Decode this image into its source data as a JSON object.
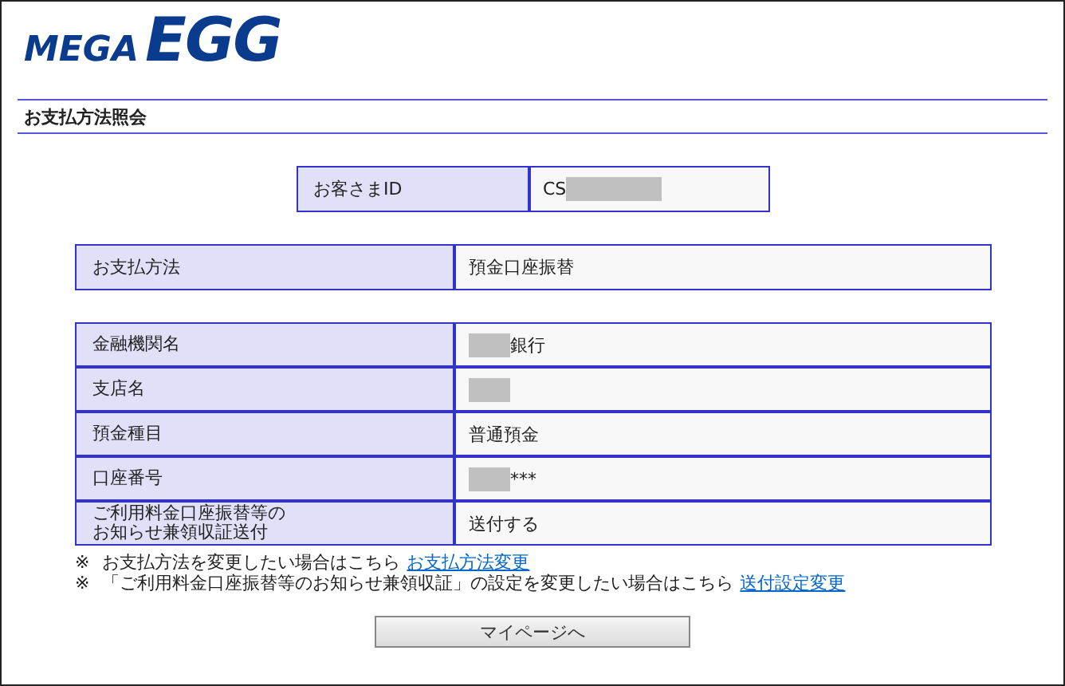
{
  "logo": {
    "part1": "MEGA",
    "part2": "EGG"
  },
  "page_title": "お支払方法照会",
  "customer": {
    "label": "お客さまID",
    "value": "CS",
    "redacted": true
  },
  "payment": {
    "label": "お支払方法",
    "value": "預金口座振替"
  },
  "details": [
    {
      "label": "金融機関名",
      "value": "銀行",
      "redacted": true
    },
    {
      "label": "支店名",
      "redacted": true
    },
    {
      "label": "預金種目",
      "value": "普通預金",
      "redacted": false
    },
    {
      "label": "口座番号",
      "value": "***",
      "redacted": true
    },
    {
      "label": "ご利用料金口座振替等のお知らせ兼領収証送付",
      "value": "送付する",
      "redacted": false
    }
  ],
  "notes": [
    {
      "mark": "※",
      "text": "お支払方法を変更したい場合はこちら",
      "link": "お支払方法変更"
    },
    {
      "mark": "※",
      "text": "「ご利用料金口座振替等のお知らせ兼領収証」の設定を変更したい場合はこちら",
      "link": "送付設定変更"
    }
  ],
  "button": "マイページへ"
}
